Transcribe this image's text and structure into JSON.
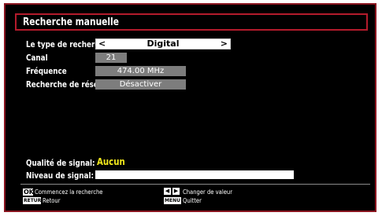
{
  "title": "Recherche manuelle",
  "settings": [
    {
      "label": "Le type de recherche",
      "value": "Digital"
    },
    {
      "label": "Canal",
      "value": "21"
    },
    {
      "label": "Fréquence",
      "value": "474.00 MHz"
    },
    {
      "label": "Recherche de réseau",
      "value": "Désactiver"
    }
  ],
  "selector_arrows": {
    "left": "<",
    "right": ">"
  },
  "signal": {
    "quality_label": "Qualité de signal:",
    "quality_value": "Aucun",
    "level_label": "Niveau de signal:"
  },
  "help": {
    "ok_key": "OK",
    "ok_text": "Commencez la recherche",
    "back_key": "RETURN",
    "back_text": "Retour",
    "change_text": "Changer de valeur",
    "menu_key": "MENU",
    "menu_text": "Quitter"
  },
  "colors": {
    "frame_border": "#8a1520",
    "title_border": "#b31b2c",
    "value_highlight": "#f1e71c",
    "field_grey": "#7d7d7d"
  }
}
